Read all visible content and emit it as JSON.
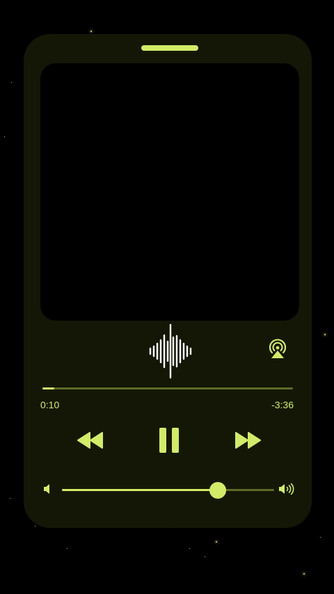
{
  "player": {
    "elapsed": "0:10",
    "remaining": "-3:36",
    "progress": 0.046,
    "volume": 0.735,
    "state": "playing"
  },
  "icons": {
    "waveform": "audio-waveform-icon",
    "airplay": "airplay-audio-icon",
    "rewind": "rewind-icon",
    "pause": "pause-icon",
    "fast_forward": "fast-forward-icon",
    "volume_low": "volume-low-icon",
    "volume_high": "volume-high-icon"
  },
  "colors": {
    "accent": "#d2ec67",
    "frame": "#151706",
    "track": "#5d6a2a",
    "background": "#000000",
    "star": "#e8d878"
  }
}
